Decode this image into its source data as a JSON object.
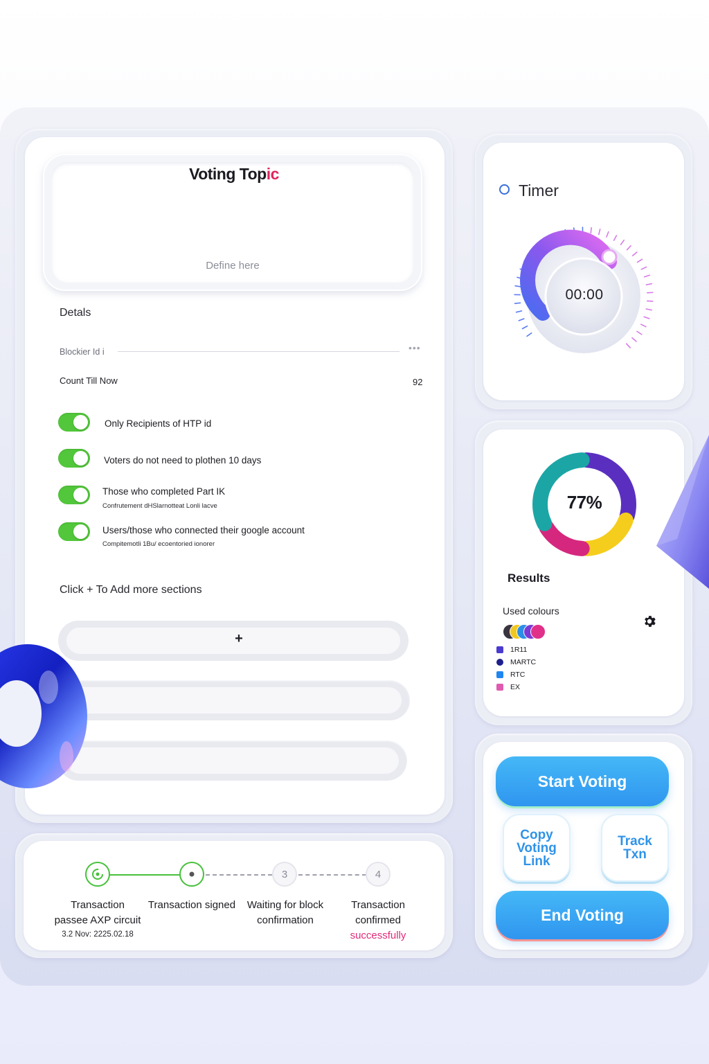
{
  "topic": {
    "title_main": "Voting Top",
    "title_accent": "ic",
    "placeholder": "Define here"
  },
  "details": {
    "heading": "Detals",
    "blocker_label": "Blockier Id i",
    "count_label": "Count Till Now",
    "count_value": "92"
  },
  "options": [
    {
      "label": "Only Recipients of HTP id",
      "sub": "",
      "enabled": true
    },
    {
      "label": "Voters do not need to plothen 10 days",
      "sub": "",
      "enabled": true
    },
    {
      "label": "Those who completed Part IK",
      "sub": "Confrutement dHSlarnotteat Lonli lacve",
      "enabled": true
    },
    {
      "label": "Users/those  who connected their google account",
      "sub": "Compitemotli 1Bu/ ecoentoried ionorer",
      "enabled": true
    }
  ],
  "sections": {
    "hint": "Click + To Add more sections",
    "add_label": "+"
  },
  "progress": {
    "steps": [
      {
        "label_line1": "Transaction",
        "label_line2": "passee AXP circuit",
        "date": "3.2 Nov: 2225.02.18",
        "status": "done"
      },
      {
        "label_line1": "Transaction signed",
        "label_line2": "",
        "status": "current"
      },
      {
        "number": "3",
        "label_line1": "Waiting for block",
        "label_line2": "confirmation",
        "status": "pending"
      },
      {
        "number": "4",
        "label_line1": "Transaction",
        "label_line2": "confirmed",
        "label_line3": "successfully",
        "status": "pending"
      }
    ]
  },
  "timer": {
    "title": "Timer",
    "value": "00:00"
  },
  "results": {
    "percent": "77%",
    "title": "Results",
    "used_colours_label": "Used colours",
    "legend": [
      {
        "label": "1R11",
        "color": "#4b3ccf"
      },
      {
        "label": "MARTC",
        "color": "#1d1f8c"
      },
      {
        "label": "RTC",
        "color": "#1f86f0"
      },
      {
        "label": "EX",
        "color": "#e05ab0"
      }
    ],
    "donut_segments": [
      {
        "color": "#5a2fc0",
        "fraction": 0.3
      },
      {
        "color": "#f5cd1c",
        "fraction": 0.2
      },
      {
        "color": "#d6277e",
        "fraction": 0.17
      },
      {
        "color": "#1ba6a5",
        "fraction": 0.33
      }
    ]
  },
  "actions": {
    "start": "Start Voting",
    "copy_line1": "Copy",
    "copy_line2": "Voting",
    "copy_line3": "Link",
    "track_line1": "Track",
    "track_line2": "Txn",
    "end": "End Voting"
  },
  "colors": {
    "accent_red": "#e0245e",
    "toggle_green": "#52c73b",
    "step_green": "#46c13a",
    "button_blue": "#2f95ef",
    "success_pink": "#e12a7a"
  }
}
